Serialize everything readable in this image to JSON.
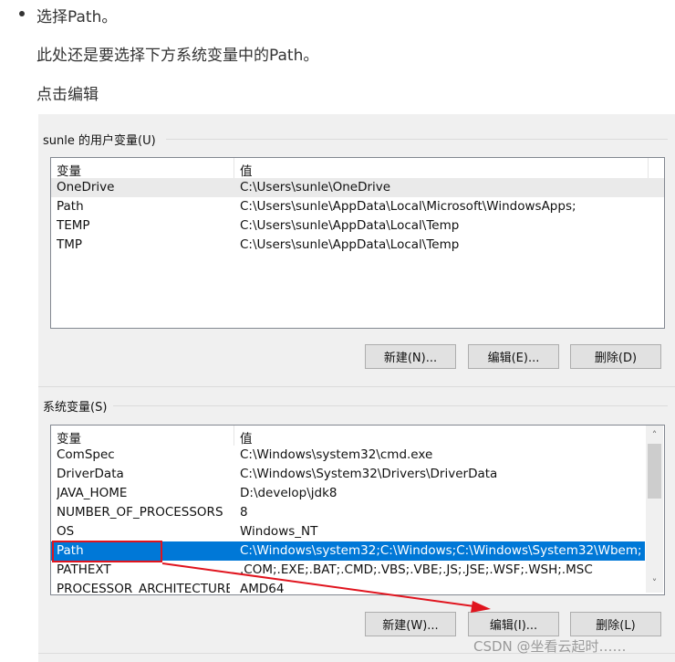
{
  "article": {
    "bullet": "选择Path。",
    "para1": "此处还是要选择下方系统变量中的Path。",
    "para2": "点击编辑"
  },
  "user_vars": {
    "group_label": "sunle 的用户变量(U)",
    "col_var": "变量",
    "col_value": "值",
    "rows": [
      {
        "name": "OneDrive",
        "value": "C:\\Users\\sunle\\OneDrive"
      },
      {
        "name": "Path",
        "value": "C:\\Users\\sunle\\AppData\\Local\\Microsoft\\WindowsApps;"
      },
      {
        "name": "TEMP",
        "value": "C:\\Users\\sunle\\AppData\\Local\\Temp"
      },
      {
        "name": "TMP",
        "value": "C:\\Users\\sunle\\AppData\\Local\\Temp"
      }
    ],
    "btn_new": "新建(N)...",
    "btn_edit": "编辑(E)...",
    "btn_delete": "删除(D)"
  },
  "sys_vars": {
    "group_label": "系统变量(S)",
    "col_var": "变量",
    "col_value": "值",
    "rows": [
      {
        "name": "ComSpec",
        "value": "C:\\Windows\\system32\\cmd.exe"
      },
      {
        "name": "DriverData",
        "value": "C:\\Windows\\System32\\Drivers\\DriverData"
      },
      {
        "name": "JAVA_HOME",
        "value": "D:\\develop\\jdk8"
      },
      {
        "name": "NUMBER_OF_PROCESSORS",
        "value": "8"
      },
      {
        "name": "OS",
        "value": "Windows_NT"
      },
      {
        "name": "Path",
        "value": "C:\\Windows\\system32;C:\\Windows;C:\\Windows\\System32\\Wbem;..."
      },
      {
        "name": "PATHEXT",
        "value": ".COM;.EXE;.BAT;.CMD;.VBS;.VBE;.JS;.JSE;.WSF;.WSH;.MSC"
      },
      {
        "name": "PROCESSOR_ARCHITECTURE",
        "value": "AMD64"
      }
    ],
    "selected_index": 5,
    "btn_new": "新建(W)...",
    "btn_edit": "编辑(I)...",
    "btn_delete": "删除(L)"
  },
  "watermark": "CSDN @坐看云起时……",
  "colors": {
    "selection": "#0078d7",
    "annotation": "#e0141e"
  }
}
